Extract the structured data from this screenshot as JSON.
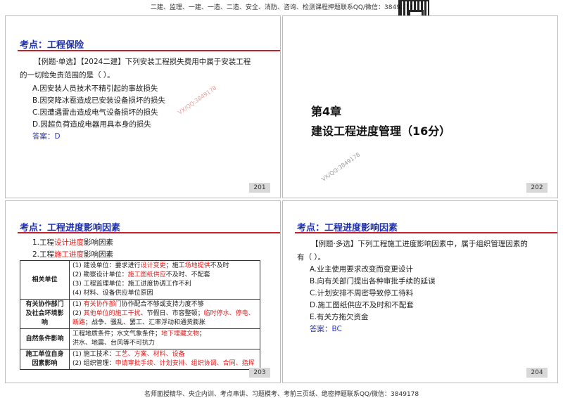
{
  "header": {
    "text": "二建、监理、一建、一造、二造、安全、消防、咨询、检测课程押题联系QQ/微信：3849178"
  },
  "footer": {
    "text": "名师面授精华、央企内训、考点串讲、习题模考、考前三页纸、绝密押题联系QQ/微信：3849178"
  },
  "watermark": "VX/QQ:3849178",
  "slides": [
    {
      "title": "考点：工程保险",
      "question": "【例题·单选】【2024二建】下列安装工程损失费用中属于安装工程的一切险免责范围的是（    ）。",
      "options": [
        "A.因安装人员技术不精引起的事故损失",
        "B.因突降冰雹造成已安装设备损坏的损失",
        "C.因遭遇雷击造成电气设备损坏的损失",
        "D.因超负荷造成电器用具本身的损失"
      ],
      "answer": "答案：D",
      "page": "201"
    },
    {
      "chapter": "第4章",
      "chapter_title": "建设工程进度管理（16分）",
      "page": "202"
    },
    {
      "title": "考点：工程进度影响因素",
      "items": [
        {
          "a": "1.工程",
          "b": "设计进度",
          "c": "影响因素"
        },
        {
          "a": "2.工程",
          "b": "施工进度",
          "c": "影响因素"
        }
      ],
      "table": [
        {
          "head": "相关单位",
          "lines": [
            [
              "(1) 建设单位：要求进行",
              "设计变更",
              "；施工",
              "场地提供",
              "不及时"
            ],
            [
              "(2) 勘察设计单位：",
              "施工图纸供应",
              "不及时、不配套"
            ],
            [
              "(3) 工程监理单位：施工进度协调工作不利"
            ],
            [
              "(4) 材料、设备供应单位原因"
            ]
          ]
        },
        {
          "head": "有关协作部门及社会环境影响",
          "lines": [
            [
              "(1) ",
              "有关协作部门",
              "协作配合不够或支持力度不够"
            ],
            [
              "(2) ",
              "其他单位的施工干扰",
              "、节假日、市容整顿；",
              "临时停水、停电、断路",
              "；战争、骚乱、罢工、汇率浮动和通货膨胀"
            ]
          ]
        },
        {
          "head": "自然条件影响",
          "lines": [
            [
              "工程地质条件；水文气象条件；",
              "地下埋藏文物",
              "；"
            ],
            [
              "洪水、地震、台风等不可抗力"
            ]
          ]
        },
        {
          "head": "施工单位自身因素影响",
          "lines": [
            [
              "(1) 施工技术：",
              "工艺、方案、材料、设备"
            ],
            [
              "(2) 组织管理：",
              "申请审批手续、计划安排、组织协调、合同、指挥"
            ]
          ]
        }
      ],
      "page": "203"
    },
    {
      "title": "考点：工程进度影响因素",
      "question": "【例题·多选】下列工程施工进度影响因素中，属于组织管理因素的有（ ）。",
      "options": [
        "A.业主使用要求改变而变更设计",
        "B.向有关部门提出各种审批手续的延误",
        "C.计划安排不周密导致停工待料",
        "D.施工图纸供应不及时和不配套",
        "E.有关方拖欠资金"
      ],
      "answer": "答案：BC",
      "page": "204"
    }
  ]
}
